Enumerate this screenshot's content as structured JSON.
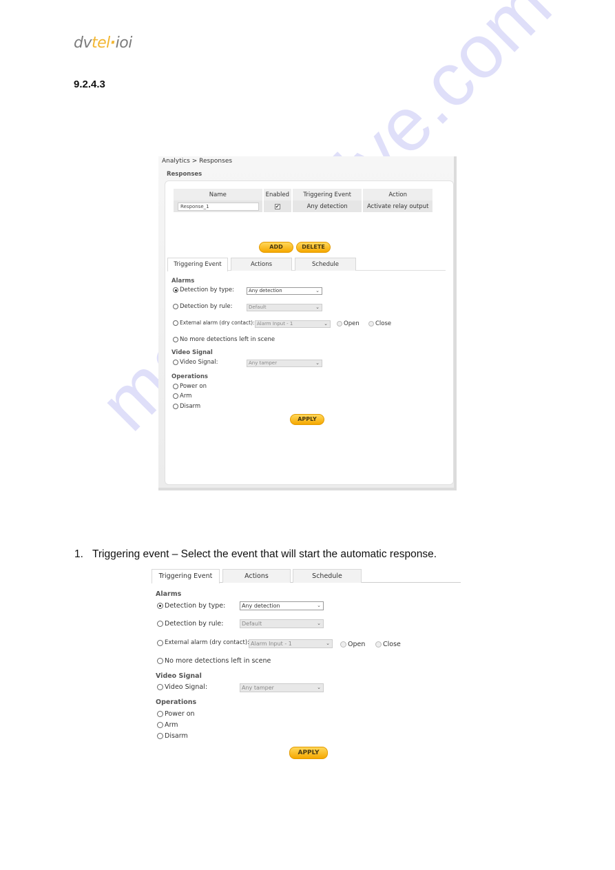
{
  "logo": {
    "part1": "dv",
    "part2": "tel",
    "dot": "·",
    "part3": "ioi"
  },
  "section_number": "9.2.4.3",
  "screenshot1": {
    "breadcrumb": "Analytics > Responses",
    "panel_title": "Responses",
    "table": {
      "headers": [
        "Name",
        "Enabled",
        "Triggering Event",
        "Action"
      ],
      "rows": [
        {
          "name": "Response_1",
          "enabled": true,
          "triggering_event": "Any detection",
          "action": "Activate relay output"
        }
      ]
    },
    "buttons": {
      "add": "ADD",
      "delete": "DELETE",
      "apply": "APPLY"
    }
  },
  "checkbox_glyph": "✔",
  "chevron_glyph": "⌄",
  "tabs": [
    "Triggering Event",
    "Actions",
    "Schedule"
  ],
  "active_tab": "Triggering Event",
  "form": {
    "alarms_heading": "Alarms",
    "detection_by_type": {
      "label": "Detection by type:",
      "selected": true,
      "value": "Any detection"
    },
    "detection_by_rule": {
      "label": "Detection by rule:",
      "selected": false,
      "value": "Default"
    },
    "external_alarm": {
      "label": "External alarm (dry contact):",
      "selected": false,
      "value": "Alarm Input - 1",
      "open_label": "Open",
      "close_label": "Close"
    },
    "no_more_detections": {
      "label": "No more detections left in scene",
      "selected": false
    },
    "video_heading": "Video Signal",
    "video_signal": {
      "label": "Video Signal:",
      "selected": false,
      "value": "Any tamper"
    },
    "operations_heading": "Operations",
    "operations": [
      {
        "label": "Power on",
        "selected": false
      },
      {
        "label": "Arm",
        "selected": false
      },
      {
        "label": "Disarm",
        "selected": false
      }
    ],
    "apply": "APPLY"
  },
  "caption": {
    "number": "1.",
    "text": "Triggering event – Select the event that will start the automatic response."
  },
  "watermark": "manualshive.com"
}
